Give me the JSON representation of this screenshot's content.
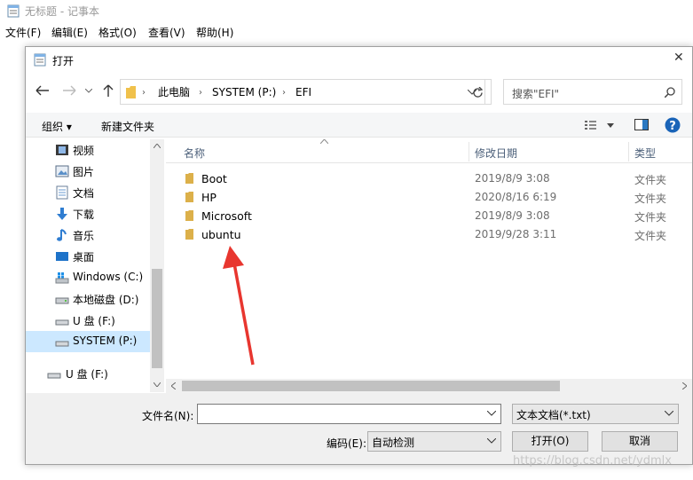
{
  "notepad": {
    "title": "无标题 - 记事本",
    "menus": [
      "文件(F)",
      "编辑(E)",
      "格式(O)",
      "查看(V)",
      "帮助(H)"
    ]
  },
  "dialog": {
    "title": "打开",
    "close": "✕",
    "path": [
      "此电脑",
      "SYSTEM (P:)",
      "EFI"
    ],
    "search_placeholder": "搜索\"EFI\"",
    "toolbar": {
      "organize": "组织 ▾",
      "new_folder": "新建文件夹"
    },
    "sidebar": [
      {
        "label": "视频",
        "icon": "video-icon"
      },
      {
        "label": "图片",
        "icon": "picture-icon"
      },
      {
        "label": "文档",
        "icon": "document-icon"
      },
      {
        "label": "下载",
        "icon": "download-icon"
      },
      {
        "label": "音乐",
        "icon": "music-icon"
      },
      {
        "label": "桌面",
        "icon": "desktop-icon"
      },
      {
        "label": "Windows (C:)",
        "icon": "windows-drive-icon"
      },
      {
        "label": "本地磁盘 (D:)",
        "icon": "drive-icon"
      },
      {
        "label": "U 盘 (F:)",
        "icon": "usb-drive-icon"
      },
      {
        "label": "SYSTEM (P:)",
        "icon": "drive-icon",
        "selected": true
      },
      {
        "label": "U 盘 (F:)",
        "icon": "usb-drive-icon"
      }
    ],
    "columns": {
      "name": "名称",
      "date": "修改日期",
      "type": "类型"
    },
    "files": [
      {
        "name": "Boot",
        "date": "2019/8/9 3:08",
        "type": "文件夹"
      },
      {
        "name": "HP",
        "date": "2020/8/16 6:19",
        "type": "文件夹"
      },
      {
        "name": "Microsoft",
        "date": "2019/8/9 3:08",
        "type": "文件夹"
      },
      {
        "name": "ubuntu",
        "date": "2019/9/28 3:11",
        "type": "文件夹"
      }
    ],
    "filename_label": "文件名(N):",
    "filename_value": "",
    "filetype": "文本文档(*.txt)",
    "encoding_label": "编码(E):",
    "encoding_value": "自动检测",
    "open_button": "打开(O)",
    "cancel_button": "取消"
  },
  "watermark": "https://blog.csdn.net/ydmlx",
  "colors": {
    "folder": "#dcb04a",
    "selected": "#cce8ff",
    "arrow": "#e8362f",
    "accent": "#0078d7"
  }
}
